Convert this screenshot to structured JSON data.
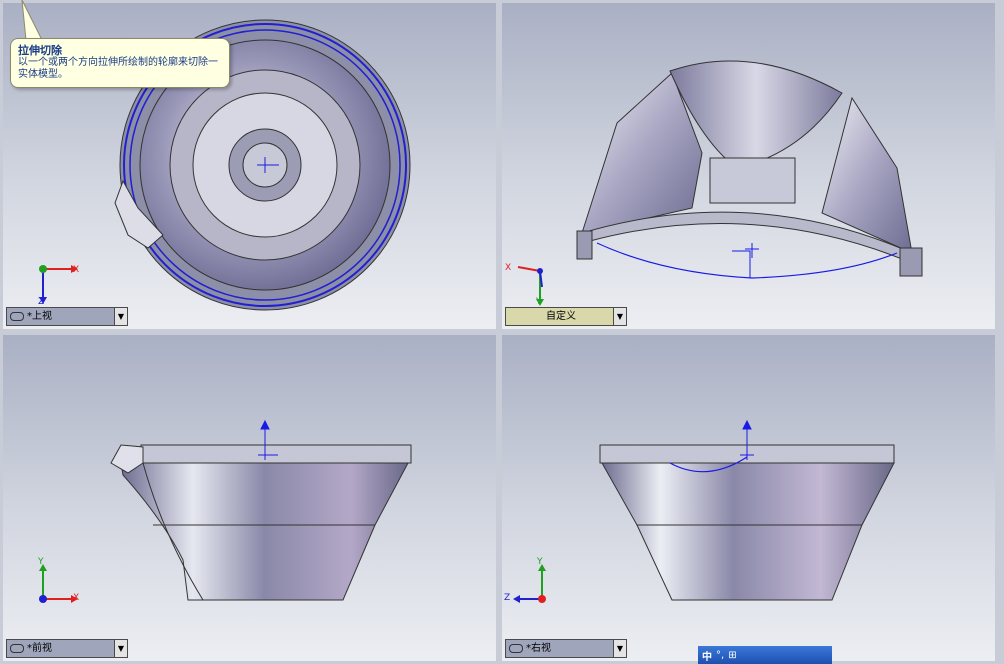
{
  "tooltip": {
    "title": "拉伸切除",
    "body": "以一个或两个方向拉伸所绘制的轮廓来切除一实体模型。"
  },
  "viewports": {
    "top": {
      "label": "*上视"
    },
    "custom": {
      "label": "自定义"
    },
    "front": {
      "label": "*前视"
    },
    "right": {
      "label": "*右视"
    }
  },
  "axes": {
    "x": "X",
    "y": "Y",
    "z": "Z"
  },
  "taskbar": {
    "ime": "中",
    "items": [
      "°,",
      "⊞"
    ]
  },
  "colors": {
    "sketch_blue": "#1a1ae6",
    "axis_red": "#e02020",
    "axis_green": "#20a020",
    "axis_blue": "#2020d0"
  }
}
